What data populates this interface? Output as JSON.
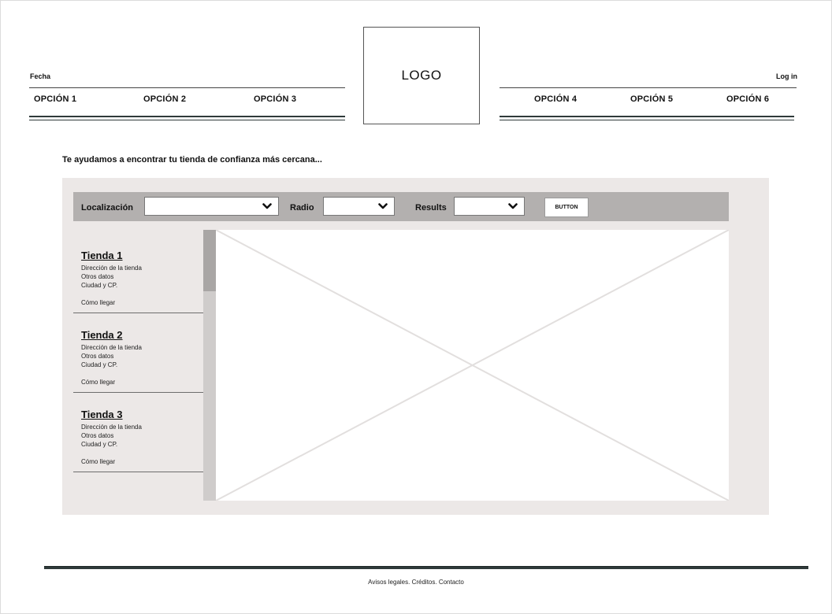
{
  "header": {
    "date_label": "Fecha",
    "login_label": "Log in",
    "logo_text": "LOGO",
    "nav_left": [
      "OPCIÓN 1",
      "OPCIÓN 2",
      "OPCIÓN 3"
    ],
    "nav_right": [
      "OPCIÓN 4",
      "OPCIÓN 5",
      "OPCIÓN 6"
    ]
  },
  "main": {
    "intro": "Te ayudamos a encontrar tu tienda de confianza más cercana..."
  },
  "filters": {
    "location_label": "Localización",
    "location_value": "",
    "radius_label": "Radio",
    "radius_value": "",
    "results_label": "Results",
    "results_value": "",
    "button_label": "BUTTON"
  },
  "stores": [
    {
      "name": "Tienda 1",
      "address": "Dirección de la tienda",
      "other": "Otros datos",
      "city": "Ciudad y CP.",
      "directions": "Cómo llegar"
    },
    {
      "name": "Tienda 2",
      "address": "Dirección de la tienda",
      "other": "Otros datos",
      "city": "Ciudad y CP.",
      "directions": "Cómo llegar"
    },
    {
      "name": "Tienda 3",
      "address": "Dirección de la tienda",
      "other": "Otros datos",
      "city": "Ciudad y CP.",
      "directions": "Cómo llegar"
    }
  ],
  "footer": {
    "links": "Avisos legales. Créditos. Contacto"
  },
  "colors": {
    "panel_bg": "#ece8e7",
    "filterbar_bg": "#b3b0af",
    "rule_dark": "#2f3a3a"
  },
  "icons": {
    "select_chevron": "chevron-down-icon",
    "map_placeholder": "image-placeholder-icon"
  }
}
